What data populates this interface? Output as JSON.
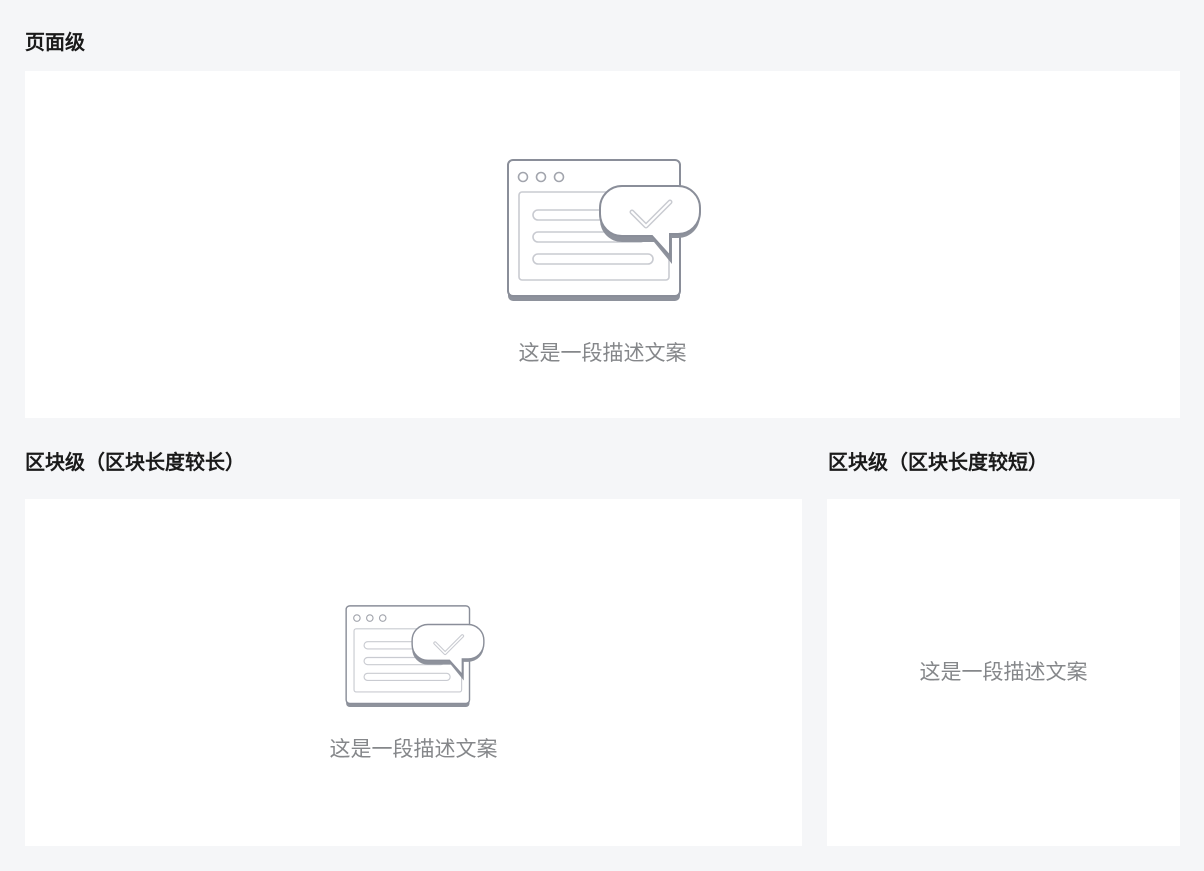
{
  "sections": {
    "page": {
      "title": "页面级",
      "description": "这是一段描述文案",
      "illustration": "empty-state-window-chat-icon"
    },
    "block_long": {
      "title": "区块级（区块长度较长）",
      "description": "这是一段描述文案",
      "illustration": "empty-state-window-chat-icon"
    },
    "block_short": {
      "title": "区块级（区块长度较短）",
      "description": "这是一段描述文案"
    }
  },
  "colors": {
    "background": "#f5f6f8",
    "card": "#ffffff",
    "text_title": "#1a1a1a",
    "text_desc": "#85878a",
    "illustration_stroke": "#8a8e99",
    "illustration_light": "#c9cbd1"
  }
}
